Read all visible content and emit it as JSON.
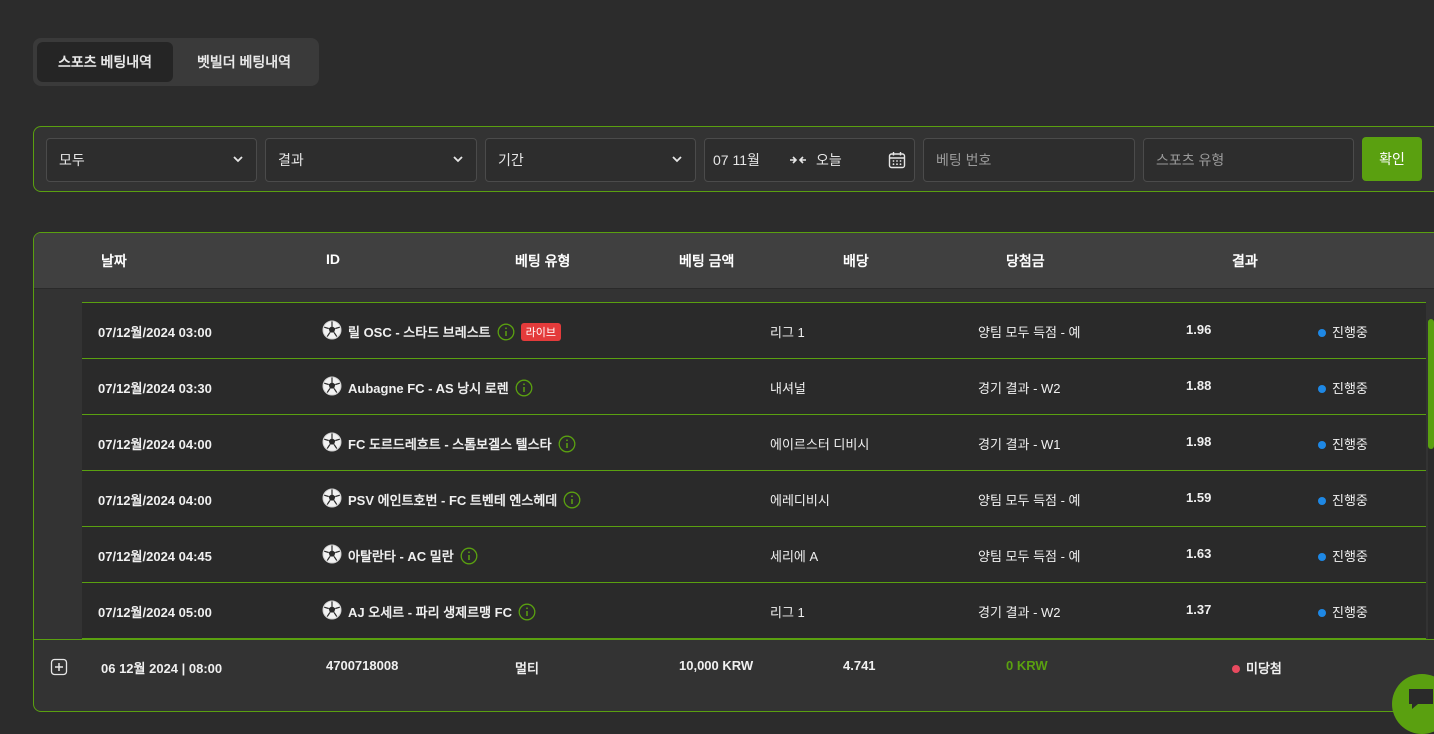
{
  "tabs": [
    {
      "label": "스포츠 베팅내역",
      "active": true
    },
    {
      "label": "벳빌더 베팅내역",
      "active": false
    }
  ],
  "filters": {
    "type_select": "모두",
    "result_select": "결과",
    "period_select": "기간",
    "date_from": "07 11월",
    "date_to": "오늘",
    "bet_number_placeholder": "베팅 번호",
    "sport_type_placeholder": "스포츠 유형",
    "confirm_label": "확인"
  },
  "table": {
    "headers": {
      "date": "날짜",
      "id": "ID",
      "bet_type": "베팅 유형",
      "stake": "베팅 금액",
      "odds": "배당",
      "winnings": "당첨금",
      "result": "결과"
    },
    "rows": [
      {
        "date": "07/12월/2024 03:00",
        "match": "릴 OSC - 스타드 브레스트",
        "live": "라이브",
        "league": "리그 1",
        "market": "양팀 모두 득점 - 예",
        "odds": "1.96",
        "status": "진행중"
      },
      {
        "date": "07/12월/2024 03:30",
        "match": "Aubagne FC - AS 낭시 로렌",
        "live": "",
        "league": "내셔널",
        "market": "경기 결과 - W2",
        "odds": "1.88",
        "status": "진행중"
      },
      {
        "date": "07/12월/2024 04:00",
        "match": "FC 도르드레흐트 - 스톰보겔스 텔스타",
        "live": "",
        "league": "에이르스터 디비시",
        "market": "경기 결과 - W1",
        "odds": "1.98",
        "status": "진행중"
      },
      {
        "date": "07/12월/2024 04:00",
        "match": "PSV 에인트호번 - FC 트벤테 엔스헤데",
        "live": "",
        "league": "에레디비시",
        "market": "양팀 모두 득점 - 예",
        "odds": "1.59",
        "status": "진행중"
      },
      {
        "date": "07/12월/2024 04:45",
        "match": "아탈란타 - AC 밀란",
        "live": "",
        "league": "세리에 A",
        "market": "양팀 모두 득점 - 예",
        "odds": "1.63",
        "status": "진행중"
      },
      {
        "date": "07/12월/2024 05:00",
        "match": "AJ 오세르 - 파리 생제르맹 FC",
        "live": "",
        "league": "리그 1",
        "market": "경기 결과 - W2",
        "odds": "1.37",
        "status": "진행중"
      }
    ],
    "summary": {
      "date": "06 12월 2024 | 08:00",
      "id": "4700718008",
      "bet_type": "멀티",
      "stake": "10,000 KRW",
      "odds": "4.741",
      "winnings": "0 KRW",
      "result": "미당첨"
    }
  },
  "colors": {
    "accent": "#5aa010",
    "live_badge": "#e43b3b",
    "status_in_progress": "#1e88e5",
    "status_lost": "#e84a5f"
  },
  "icons": {
    "dropdown": "chevron-down-icon",
    "date_range": "arrows-icon",
    "calendar": "calendar-icon",
    "sport": "soccer-ball-icon",
    "info": "info-icon",
    "expand": "plus-square-icon",
    "chat": "chat-icon"
  }
}
